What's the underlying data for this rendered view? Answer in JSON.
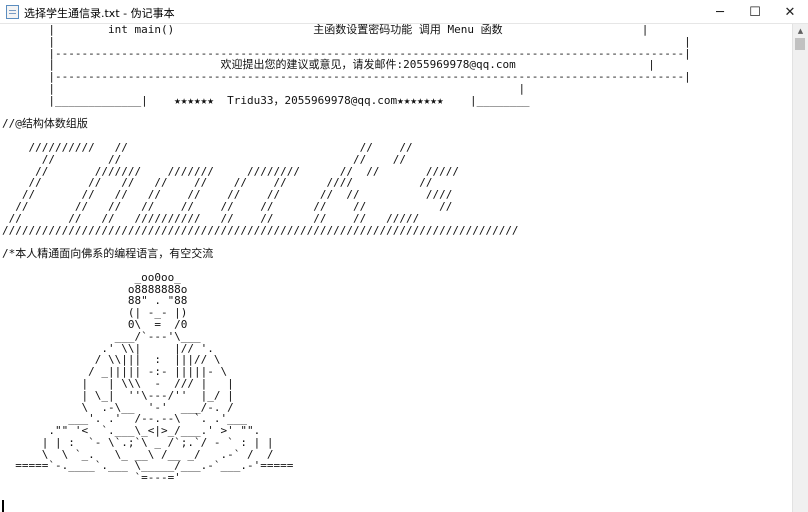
{
  "window": {
    "title": "选择学生通信录.txt - 伪记事本",
    "minimize_label": "─",
    "maximize_label": "☐",
    "close_label": "✕"
  },
  "editor": {
    "text": "       |        int main()                     主函数设置密码功能 调用 Menu 函数                     |\n       |                                                                                               |\n       |-----------------------------------------------------------------------------------------------|\n       |                         欢迎提出您的建议或意见，请发邮件:2055969978@qq.com                    |\n       |-----------------------------------------------------------------------------------------------|\n       |                                                                      |\n       |_____________|    ★★★★★★  Tridu33，2055969978@qq.com★★★★★★★    |________\n\n//@结构体数组版\n\n    //////////   //                                   //    //\n      //        //                                   //    //\n     //       ///////    ///////     ////////      //  //       /////\n    //       //   //   //    //    //    //      ////          //\n   //       //   //   //    //    //    //      //  //          ////\n  //       //   //   //    //    //    //      //    //           //\n //       //   //   //////////   //    //      //    //   /////\n//////////////////////////////////////////////////////////////////////////////\n\n/*本人精通面向佛系的编程语言，有空交流\n\n                    _oo0oo_\n                   o8888888o\n                   88\" . \"88\n                   (| -_- |)\n                   0\\  =  /0\n                 ___/`---'\\___\n               .' \\\\|     |// '.\n              / \\\\|||  :  |||// \\\n             / _||||| -:- |||||- \\\n            |   | \\\\\\  -  /// |   |\n            | \\_|  ''\\---/''  |_/ |\n            \\  .-\\__  '-'  ___/-. /\n          ___'. .'  /--.--\\  `. .'___\n       .\"\" '<  `.___\\_<|>_/___.' >' \"\".\n      | | :  `- \\`.;`\\ _ /`;.`/ - ` : | |\n      \\  \\ `_.   \\_ __\\ /__ _/   .-` /  /\n  =====`-.____`.___ \\_____/___.-`___.-'=====\n                    `=---='"
  }
}
